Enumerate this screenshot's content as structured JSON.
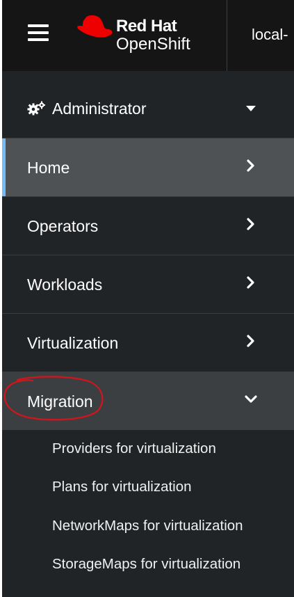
{
  "masthead": {
    "brand_line1": "Red Hat",
    "brand_line2": "OpenShift",
    "cluster_text": "local-",
    "menu_icon": "hamburger-icon"
  },
  "perspective": {
    "label": "Administrator",
    "icon": "gears-icon",
    "caret_icon": "caret-down-icon"
  },
  "nav": {
    "items": [
      {
        "label": "Home",
        "state": "active",
        "icon": "chevron-right-icon"
      },
      {
        "label": "Operators",
        "state": "collapsed",
        "icon": "chevron-right-icon"
      },
      {
        "label": "Workloads",
        "state": "collapsed",
        "icon": "chevron-right-icon"
      },
      {
        "label": "Virtualization",
        "state": "collapsed",
        "icon": "chevron-right-icon"
      },
      {
        "label": "Migration",
        "state": "expanded",
        "icon": "chevron-down-icon"
      }
    ],
    "migration_subitems": [
      "Providers for virtualization",
      "Plans for virtualization",
      "NetworkMaps for virtualization",
      "StorageMaps for virtualization"
    ]
  },
  "colors": {
    "sidebar_bg": "#212427",
    "masthead_bg": "#151515",
    "active_bg": "#4f5255",
    "expanded_bg": "#3c3f42",
    "active_indicator": "#73bcf7",
    "brand_red": "#ee0000",
    "annotation_red": "#d4141a"
  }
}
